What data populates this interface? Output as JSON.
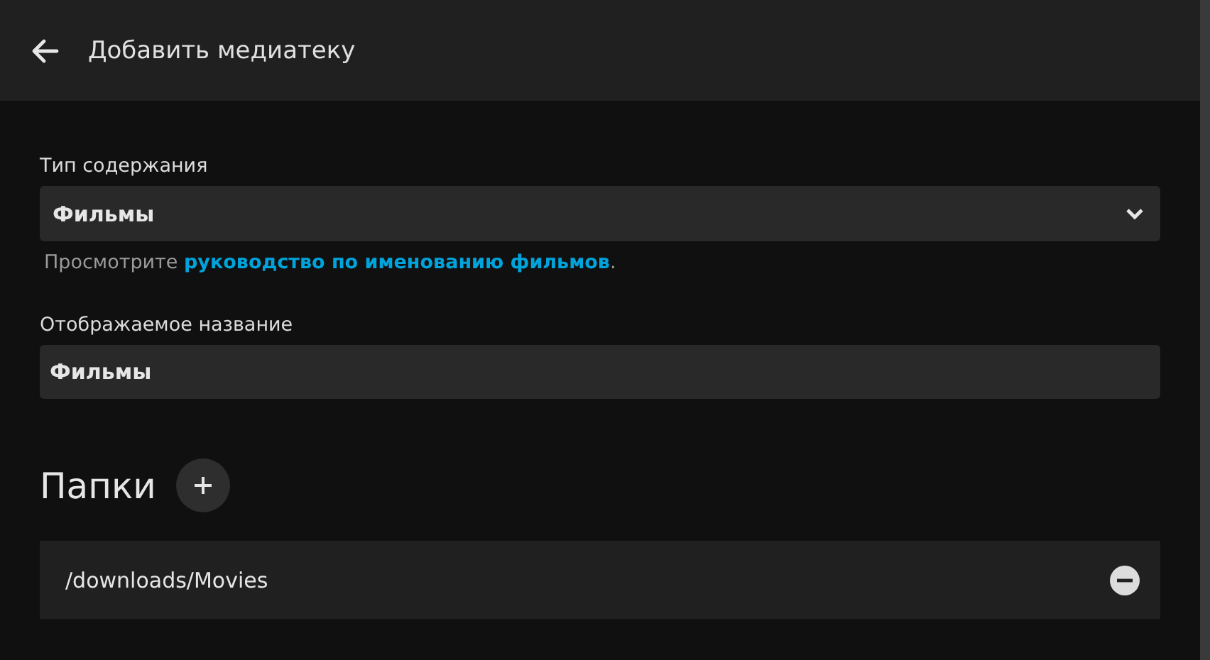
{
  "header": {
    "title": "Добавить медиатеку"
  },
  "content_type": {
    "label": "Тип содержания",
    "value": "Фильмы",
    "hint": {
      "text": "Просмотрите ",
      "link": "руководство по именованию фильмов",
      "suffix": "."
    }
  },
  "display_name": {
    "label": "Отображаемое название",
    "value": "Фильмы"
  },
  "folders": {
    "heading": "Папки",
    "items": [
      {
        "path": "/downloads/Movies"
      }
    ]
  }
}
